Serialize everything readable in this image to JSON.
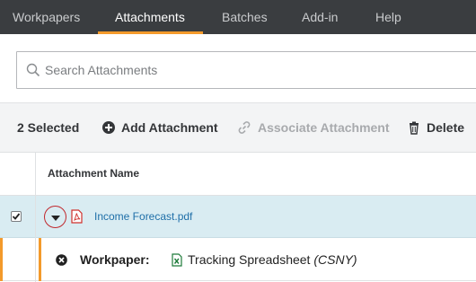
{
  "nav": {
    "tabs": [
      {
        "label": "Workpapers",
        "active": false
      },
      {
        "label": "Attachments",
        "active": true
      },
      {
        "label": "Batches",
        "active": false
      },
      {
        "label": "Add-in",
        "active": false
      },
      {
        "label": "Help",
        "active": false
      }
    ]
  },
  "search": {
    "placeholder": "Search Attachments",
    "icon": "search-icon"
  },
  "toolbar": {
    "selected_label": "2 Selected",
    "add_label": "Add Attachment",
    "associate_label": "Associate Attachment",
    "delete_label": "Delete"
  },
  "table": {
    "column_header": "Attachment Name",
    "rows": [
      {
        "checked": true,
        "file_name": "Income Forecast.pdf",
        "file_icon": "pdf-icon",
        "expanded": true,
        "sub": {
          "label": "Workpaper:",
          "name": "Tracking Spreadsheet",
          "name_suffix": "(CSNY)",
          "icon": "excel-icon"
        }
      }
    ]
  },
  "colors": {
    "nav_bg": "#3a3d40",
    "accent": "#f39a2b",
    "selected_row": "#d9ecf2",
    "link": "#1f6fa8",
    "highlight_circle": "#c0282d"
  }
}
